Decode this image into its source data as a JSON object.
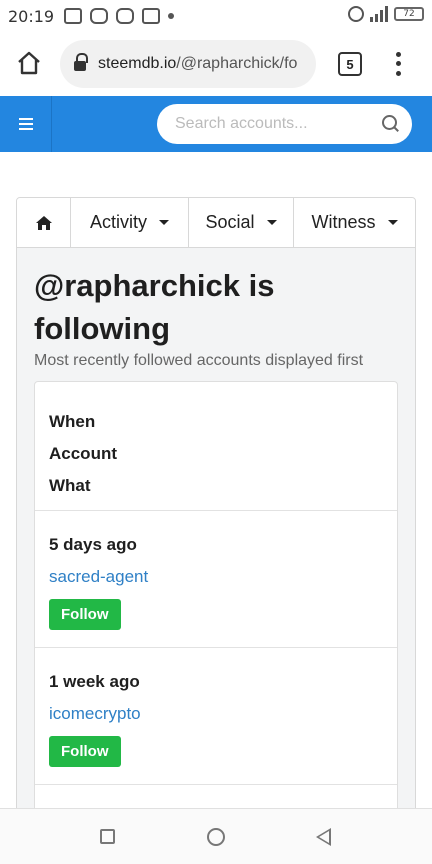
{
  "status_bar": {
    "time": "20:19",
    "battery": "72"
  },
  "browser": {
    "url_domain": "steemdb.io",
    "url_path": "/@rapharchick/fo",
    "tab_count": "5"
  },
  "site_header": {
    "search_placeholder": "Search accounts..."
  },
  "nav_tabs": {
    "activity": "Activity",
    "social": "Social",
    "witness": "Witness"
  },
  "page": {
    "title": "@rapharchick is following",
    "subtitle": "Most recently followed accounts displayed first"
  },
  "table": {
    "headers": [
      "When",
      "Account",
      "What"
    ],
    "rows": [
      {
        "when": "5 days ago",
        "account": "sacred-agent",
        "action": "Follow"
      },
      {
        "when": "1 week ago",
        "account": "icomecrypto",
        "action": "Follow"
      }
    ]
  },
  "colors": {
    "header_blue": "#2386e0",
    "follow_green": "#22b846",
    "link_blue": "#2f80c6"
  }
}
